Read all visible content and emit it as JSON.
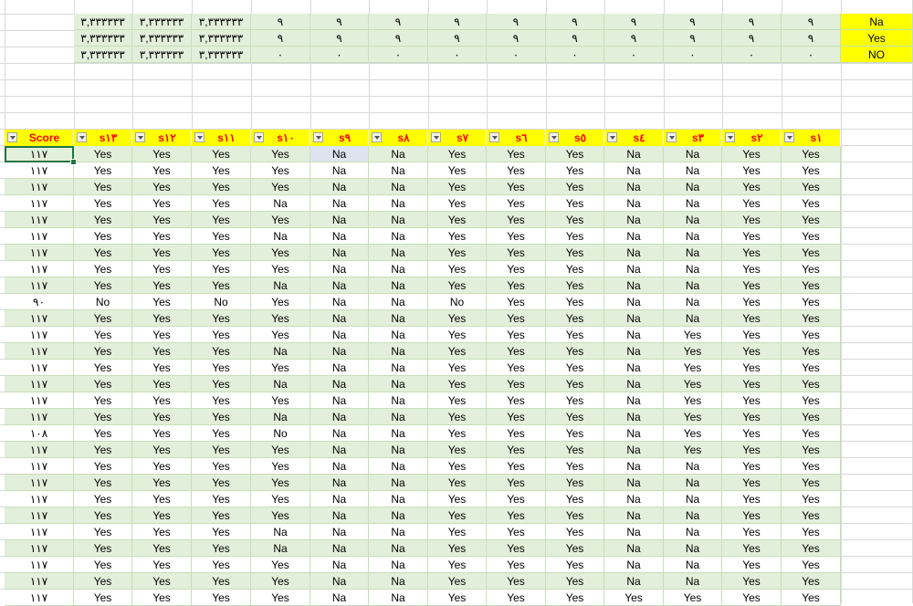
{
  "summary": {
    "rows": [
      {
        "values": [
          "٣,٣٣٣٣٣٣",
          "٣,٣٣٣٣٣٣",
          "٣,٣٣٣٣٣٣",
          "٩",
          "٩",
          "٩",
          "٩",
          "٩",
          "٩",
          "٩",
          "٩",
          "٩",
          "٩"
        ],
        "label": "Na"
      },
      {
        "values": [
          "٣,٣٣٣٣٣٣",
          "٣,٣٣٣٣٣٣",
          "٣,٣٣٣٣٣٣",
          "٩",
          "٩",
          "٩",
          "٩",
          "٩",
          "٩",
          "٩",
          "٩",
          "٩",
          "٩"
        ],
        "label": "Yes"
      },
      {
        "values": [
          "٣,٣٣٣٣٣٣",
          "٣,٣٣٣٣٣٣",
          "٣,٣٣٣٣٣٣",
          "٠",
          "٠",
          "٠",
          "٠",
          "٠",
          "٠",
          "٠",
          "٠",
          "٠",
          "٠"
        ],
        "label": "NO"
      }
    ]
  },
  "table": {
    "headers": [
      "Score",
      "s١٣",
      "s١٢",
      "s١١",
      "s١٠",
      "s٩",
      "s٨",
      "s٧",
      "s٦",
      "s٥",
      "s٤",
      "s٣",
      "s٢",
      "s١"
    ],
    "rows": [
      [
        "١١٧",
        "Yes",
        "Yes",
        "Yes",
        "Yes",
        "Na",
        "Na",
        "Yes",
        "Yes",
        "Yes",
        "Na",
        "Na",
        "Yes",
        "Yes"
      ],
      [
        "١١٧",
        "Yes",
        "Yes",
        "Yes",
        "Yes",
        "Na",
        "Na",
        "Yes",
        "Yes",
        "Yes",
        "Na",
        "Na",
        "Yes",
        "Yes"
      ],
      [
        "١١٧",
        "Yes",
        "Yes",
        "Yes",
        "Yes",
        "Na",
        "Na",
        "Yes",
        "Yes",
        "Yes",
        "Na",
        "Na",
        "Yes",
        "Yes"
      ],
      [
        "١١٧",
        "Yes",
        "Yes",
        "Yes",
        "Na",
        "Na",
        "Na",
        "Yes",
        "Yes",
        "Yes",
        "Na",
        "Na",
        "Yes",
        "Yes"
      ],
      [
        "١١٧",
        "Yes",
        "Yes",
        "Yes",
        "Yes",
        "Na",
        "Na",
        "Yes",
        "Yes",
        "Yes",
        "Na",
        "Na",
        "Yes",
        "Yes"
      ],
      [
        "١١٧",
        "Yes",
        "Yes",
        "Yes",
        "Na",
        "Na",
        "Na",
        "Yes",
        "Yes",
        "Yes",
        "Na",
        "Na",
        "Yes",
        "Yes"
      ],
      [
        "١١٧",
        "Yes",
        "Yes",
        "Yes",
        "Yes",
        "Na",
        "Na",
        "Yes",
        "Yes",
        "Yes",
        "Na",
        "Na",
        "Yes",
        "Yes"
      ],
      [
        "١١٧",
        "Yes",
        "Yes",
        "Yes",
        "Yes",
        "Na",
        "Na",
        "Yes",
        "Yes",
        "Yes",
        "Na",
        "Na",
        "Yes",
        "Yes"
      ],
      [
        "١١٧",
        "Yes",
        "Yes",
        "Yes",
        "Na",
        "Na",
        "Na",
        "Yes",
        "Yes",
        "Yes",
        "Na",
        "Na",
        "Yes",
        "Yes"
      ],
      [
        "٩٠",
        "No",
        "Yes",
        "No",
        "Yes",
        "Na",
        "Na",
        "No",
        "Yes",
        "Yes",
        "Na",
        "Na",
        "Yes",
        "Yes"
      ],
      [
        "١١٧",
        "Yes",
        "Yes",
        "Yes",
        "Yes",
        "Na",
        "Na",
        "Yes",
        "Yes",
        "Yes",
        "Na",
        "Na",
        "Yes",
        "Yes"
      ],
      [
        "١١٧",
        "Yes",
        "Yes",
        "Yes",
        "Yes",
        "Na",
        "Na",
        "Yes",
        "Yes",
        "Yes",
        "Na",
        "Yes",
        "Yes",
        "Yes"
      ],
      [
        "١١٧",
        "Yes",
        "Yes",
        "Yes",
        "Na",
        "Na",
        "Na",
        "Yes",
        "Yes",
        "Yes",
        "Na",
        "Yes",
        "Yes",
        "Yes"
      ],
      [
        "١١٧",
        "Yes",
        "Yes",
        "Yes",
        "Yes",
        "Na",
        "Na",
        "Yes",
        "Yes",
        "Yes",
        "Na",
        "Yes",
        "Yes",
        "Yes"
      ],
      [
        "١١٧",
        "Yes",
        "Yes",
        "Yes",
        "Na",
        "Na",
        "Na",
        "Yes",
        "Yes",
        "Yes",
        "Na",
        "Yes",
        "Yes",
        "Yes"
      ],
      [
        "١١٧",
        "Yes",
        "Yes",
        "Yes",
        "Yes",
        "Na",
        "Na",
        "Yes",
        "Yes",
        "Yes",
        "Na",
        "Yes",
        "Yes",
        "Yes"
      ],
      [
        "١١٧",
        "Yes",
        "Yes",
        "Yes",
        "Na",
        "Na",
        "Na",
        "Yes",
        "Yes",
        "Yes",
        "Na",
        "Yes",
        "Yes",
        "Yes"
      ],
      [
        "١٠٨",
        "Yes",
        "Yes",
        "Yes",
        "No",
        "Na",
        "Na",
        "Yes",
        "Yes",
        "Yes",
        "Na",
        "Yes",
        "Yes",
        "Yes"
      ],
      [
        "١١٧",
        "Yes",
        "Yes",
        "Yes",
        "Yes",
        "Na",
        "Na",
        "Yes",
        "Yes",
        "Yes",
        "Na",
        "Yes",
        "Yes",
        "Yes"
      ],
      [
        "١١٧",
        "Yes",
        "Yes",
        "Yes",
        "Yes",
        "Na",
        "Na",
        "Yes",
        "Yes",
        "Yes",
        "Na",
        "Na",
        "Yes",
        "Yes"
      ],
      [
        "١١٧",
        "Yes",
        "Yes",
        "Yes",
        "Yes",
        "Na",
        "Na",
        "Yes",
        "Yes",
        "Yes",
        "Na",
        "Na",
        "Yes",
        "Yes"
      ],
      [
        "١١٧",
        "Yes",
        "Yes",
        "Yes",
        "Yes",
        "Na",
        "Na",
        "Yes",
        "Yes",
        "Yes",
        "Na",
        "Na",
        "Yes",
        "Yes"
      ],
      [
        "١١٧",
        "Yes",
        "Yes",
        "Yes",
        "Yes",
        "Na",
        "Na",
        "Yes",
        "Yes",
        "Yes",
        "Na",
        "Na",
        "Yes",
        "Yes"
      ],
      [
        "١١٧",
        "Yes",
        "Yes",
        "Yes",
        "Na",
        "Na",
        "Na",
        "Yes",
        "Yes",
        "Yes",
        "Na",
        "Na",
        "Yes",
        "Yes"
      ],
      [
        "١١٧",
        "Yes",
        "Yes",
        "Yes",
        "Na",
        "Na",
        "Na",
        "Yes",
        "Yes",
        "Yes",
        "Na",
        "Na",
        "Yes",
        "Yes"
      ],
      [
        "١١٧",
        "Yes",
        "Yes",
        "Yes",
        "Yes",
        "Na",
        "Na",
        "Yes",
        "Yes",
        "Yes",
        "Na",
        "Na",
        "Yes",
        "Yes"
      ],
      [
        "١١٧",
        "Yes",
        "Yes",
        "Yes",
        "Yes",
        "Na",
        "Na",
        "Yes",
        "Yes",
        "Yes",
        "Na",
        "Na",
        "Yes",
        "Yes"
      ],
      [
        "١١٧",
        "Yes",
        "Yes",
        "Yes",
        "Yes",
        "Na",
        "Na",
        "Yes",
        "Yes",
        "Yes",
        "Yes",
        "Yes",
        "Yes",
        "Yes"
      ]
    ]
  },
  "colors": {
    "header_bg": "#ffff00",
    "header_text": "#ff0000",
    "band": "#e2efda",
    "selected": "#dde4ef",
    "grid": "#d9d9d9"
  }
}
